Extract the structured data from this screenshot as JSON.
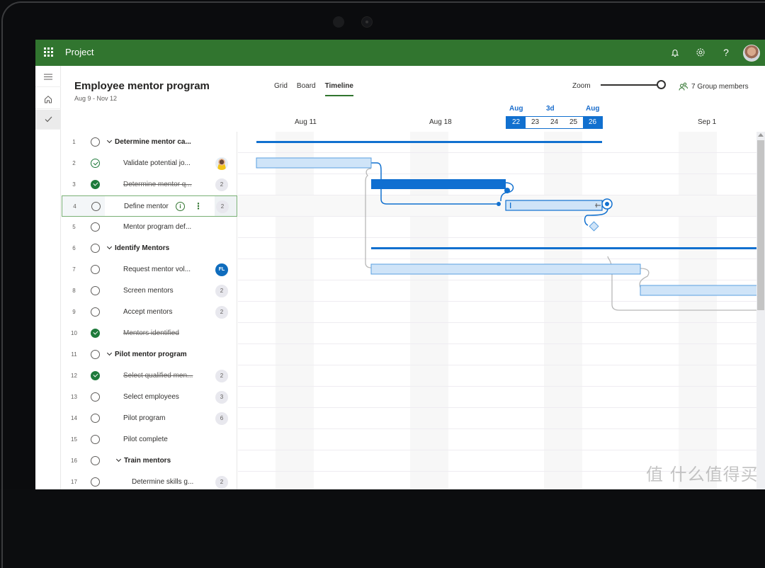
{
  "app": {
    "title": "Project",
    "icons": [
      "waffle-icon",
      "bell-icon",
      "gear-icon",
      "help-icon",
      "avatar"
    ]
  },
  "rail": {
    "items": [
      {
        "name": "menu",
        "icon": "hamburger-icon"
      },
      {
        "name": "home",
        "icon": "home-icon"
      },
      {
        "name": "tasks",
        "icon": "checkmark-icon",
        "active": true
      }
    ]
  },
  "project": {
    "title": "Employee mentor program",
    "dates": "Aug 9 - Nov 12"
  },
  "views": {
    "tabs": [
      {
        "label": "Grid",
        "active": false
      },
      {
        "label": "Board",
        "active": false
      },
      {
        "label": "Timeline",
        "active": true
      }
    ]
  },
  "zoom": {
    "label": "Zoom",
    "level": 1.0
  },
  "members": {
    "label": "7 Group members"
  },
  "timeline": {
    "dates": [
      "Aug 11",
      "Aug 18",
      "Sep 1"
    ],
    "selection": {
      "start_month": "Aug",
      "duration": "3d",
      "end_month": "Aug",
      "days": [
        "22",
        "23",
        "24",
        "25",
        "26"
      ]
    }
  },
  "tasks": [
    {
      "num": "1",
      "name": "Determine mentor ca...",
      "type": "group",
      "status": "open",
      "indent": 0
    },
    {
      "num": "2",
      "name": "Validate potential jo...",
      "type": "task",
      "status": "in-progress",
      "indent": 1,
      "assignee": "person"
    },
    {
      "num": "3",
      "name": "Determine mentor q...",
      "type": "task",
      "status": "done",
      "indent": 1,
      "badge": "2"
    },
    {
      "num": "4",
      "name": "Define mentor",
      "type": "task",
      "status": "open",
      "indent": 1,
      "badge": "2",
      "selected": true
    },
    {
      "num": "5",
      "name": "Mentor program def...",
      "type": "task",
      "status": "open",
      "indent": 1
    },
    {
      "num": "6",
      "name": "Identify Mentors",
      "type": "group",
      "status": "open",
      "indent": 0
    },
    {
      "num": "7",
      "name": "Request mentor vol...",
      "type": "task",
      "status": "open",
      "indent": 1,
      "badge": "FL",
      "badge_type": "initials"
    },
    {
      "num": "8",
      "name": "Screen mentors",
      "type": "task",
      "status": "open",
      "indent": 1,
      "badge": "2"
    },
    {
      "num": "9",
      "name": "Accept mentors",
      "type": "task",
      "status": "open",
      "indent": 1,
      "badge": "2"
    },
    {
      "num": "10",
      "name": "Mentors identified",
      "type": "task",
      "status": "done",
      "indent": 1
    },
    {
      "num": "11",
      "name": "Pilot mentor program",
      "type": "group",
      "status": "open",
      "indent": 0
    },
    {
      "num": "12",
      "name": "Select qualified men...",
      "type": "task",
      "status": "done",
      "indent": 1,
      "badge": "2"
    },
    {
      "num": "13",
      "name": "Select employees",
      "type": "task",
      "status": "open",
      "indent": 1,
      "badge": "3"
    },
    {
      "num": "14",
      "name": "Pilot program",
      "type": "task",
      "status": "open",
      "indent": 1,
      "badge": "6"
    },
    {
      "num": "15",
      "name": "Pilot complete",
      "type": "task",
      "status": "open",
      "indent": 1
    },
    {
      "num": "16",
      "name": "Train mentors",
      "type": "group",
      "status": "open",
      "indent": 1
    },
    {
      "num": "17",
      "name": "Determine skills g...",
      "type": "task",
      "status": "open",
      "indent": 2,
      "badge": "2"
    }
  ],
  "colors": {
    "brand": "#31752f",
    "accent": "#1170cf",
    "bar_fill": "#cfe4f8",
    "bar_border": "#5a9fe0",
    "done": "#1e7a3b"
  },
  "watermark": "值 什么值得买"
}
